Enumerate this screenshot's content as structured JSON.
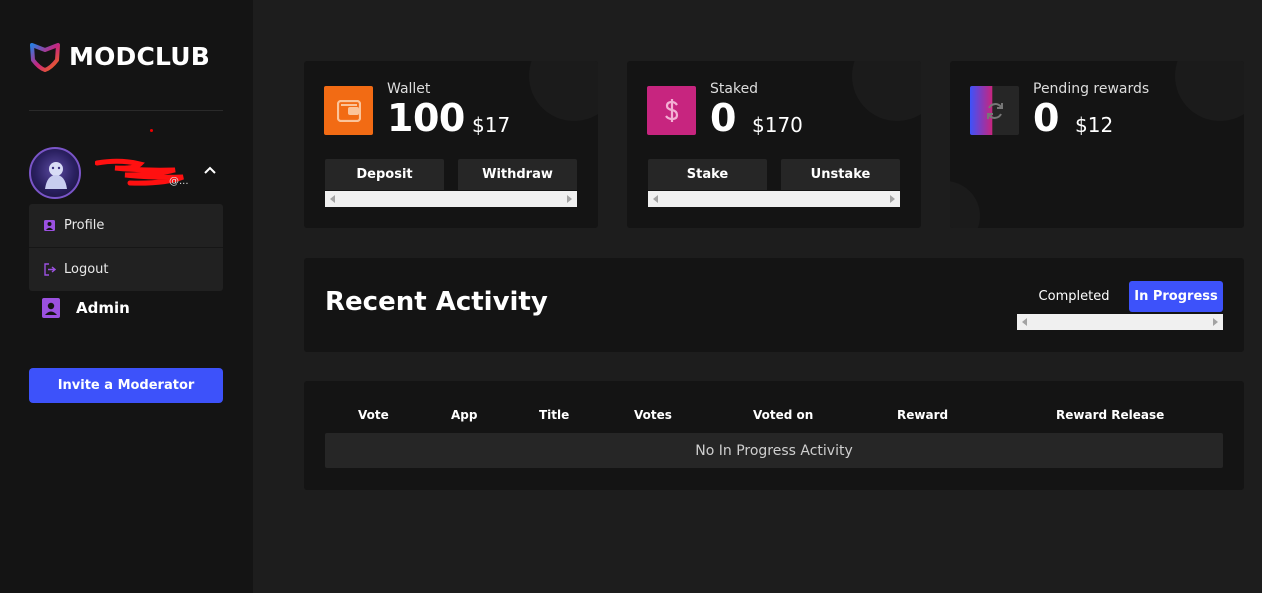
{
  "brand": {
    "name": "MODCLUB"
  },
  "user": {
    "email_suffix": "@..."
  },
  "menu": {
    "profile": "Profile",
    "logout": "Logout",
    "admin": "Admin"
  },
  "invite_label": "Invite a Moderator",
  "cards": {
    "wallet": {
      "label": "Wallet",
      "amount": "100",
      "usd": "$17",
      "deposit": "Deposit",
      "withdraw": "Withdraw",
      "icon": "wallet-icon",
      "color": "#f26b14"
    },
    "staked": {
      "label": "Staked",
      "amount": "0",
      "usd": "$170",
      "stake": "Stake",
      "unstake": "Unstake",
      "icon": "dollar-icon",
      "color": "#c7257f"
    },
    "pending": {
      "label": "Pending rewards",
      "amount": "0",
      "usd": "$12",
      "icon": "refresh-icon"
    }
  },
  "activity": {
    "title": "Recent Activity",
    "tabs": [
      "Completed",
      "In Progress"
    ],
    "active_tab": "In Progress"
  },
  "table": {
    "columns": [
      "Vote",
      "App",
      "Title",
      "Votes",
      "Voted on",
      "Reward",
      "Reward Release"
    ],
    "empty_text": "No In Progress Activity"
  },
  "colors": {
    "accent": "#3d52fa",
    "sidebar": "#141414",
    "background": "#1d1d1d"
  }
}
